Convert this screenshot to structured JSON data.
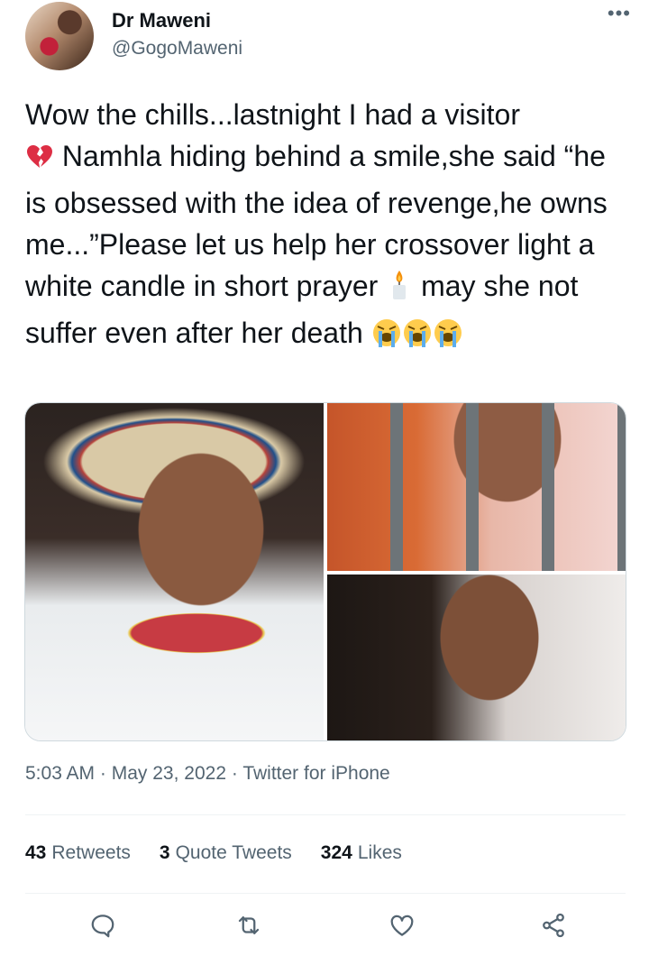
{
  "author": {
    "name": "Dr Maweni",
    "handle": "@GogoMaweni"
  },
  "tweet": {
    "text_parts": {
      "p1": "Wow the chills...lastnight I had a visitor",
      "p2": "Namhla hiding behind a smile,she said “he is obsessed with the idea of revenge,he owns me...”Please let us help her crossover light a white candle in short prayer",
      "p3": "may she not suffer even after her death"
    },
    "emojis": [
      "broken-heart-icon",
      "candle-icon",
      "crying-face-icon",
      "crying-face-icon",
      "crying-face-icon"
    ]
  },
  "meta": {
    "time": "5:03 AM",
    "date": "May 23, 2022",
    "sep": "·",
    "source": "Twitter for iPhone"
  },
  "stats": {
    "retweets_count": "43",
    "retweets_label": "Retweets",
    "quotes_count": "3",
    "quotes_label": "Quote Tweets",
    "likes_count": "324",
    "likes_label": "Likes"
  },
  "actions": [
    "reply-icon",
    "retweet-icon",
    "like-icon",
    "share-icon"
  ],
  "colors": {
    "text": "#0f1419",
    "secondary": "#536471",
    "divider": "#eff3f4"
  }
}
